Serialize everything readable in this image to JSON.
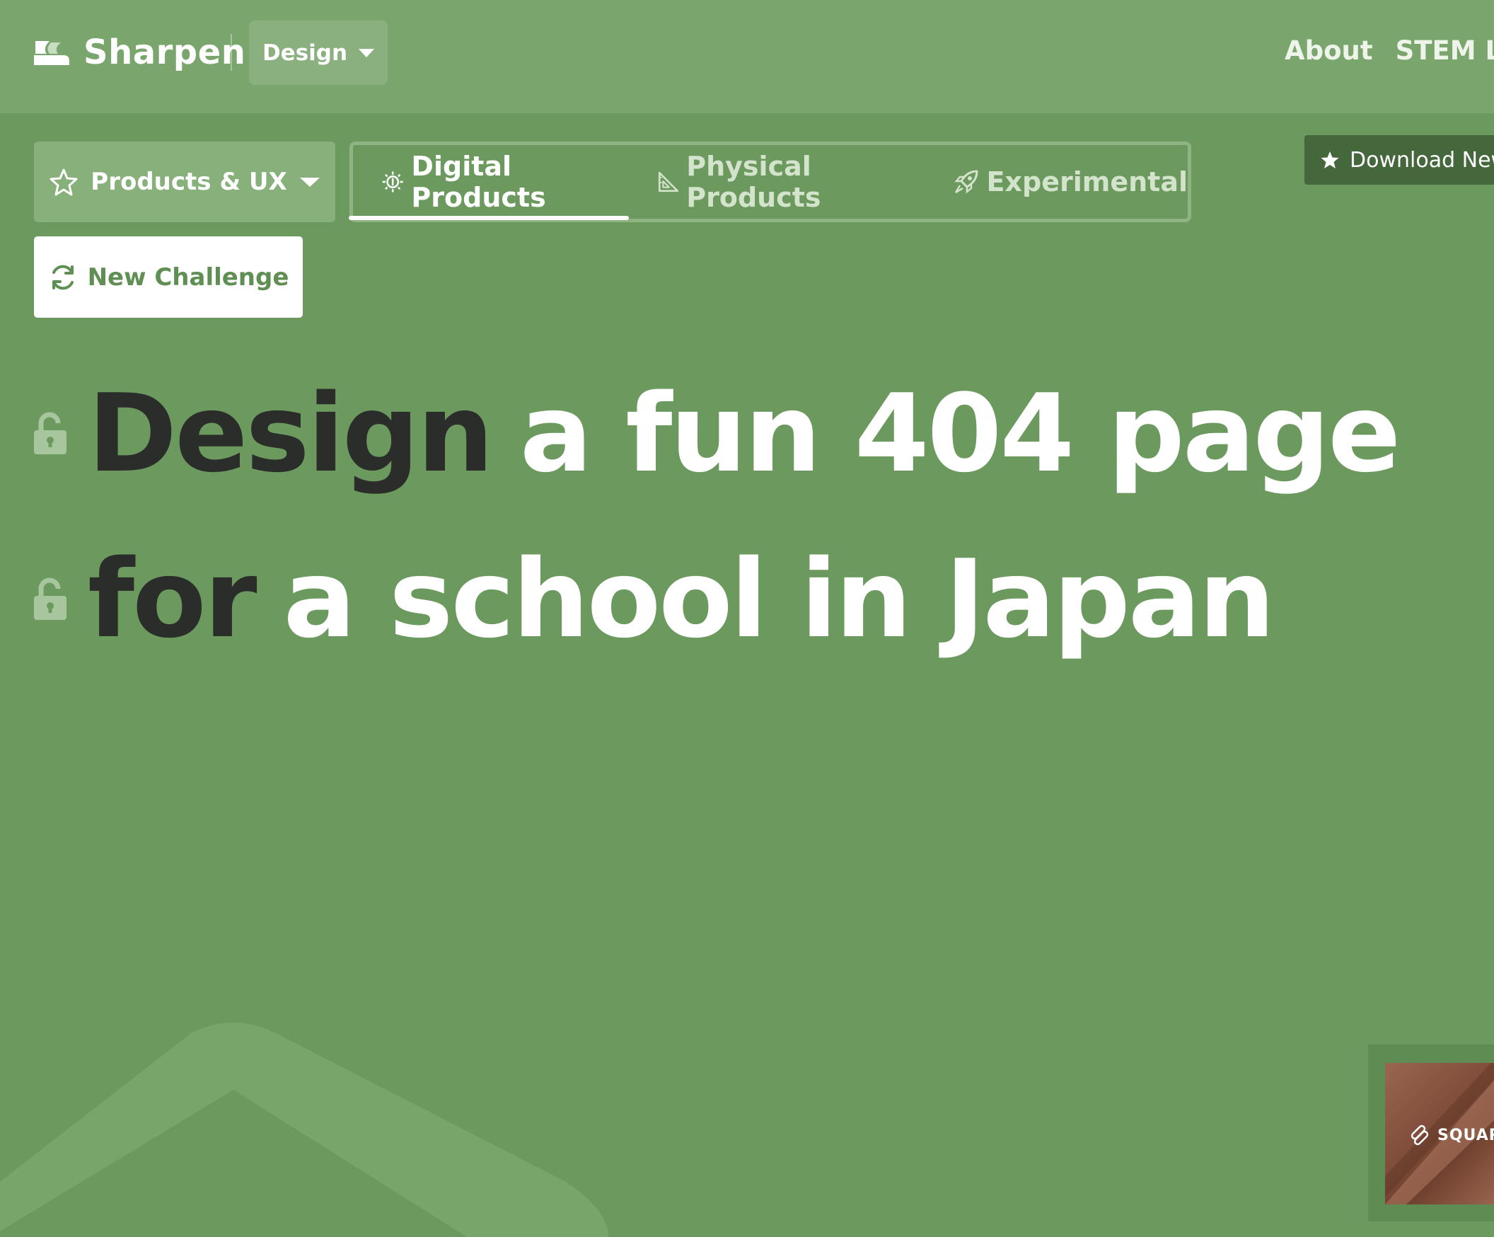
{
  "header": {
    "logo_text": "Sharpen",
    "subject_dropdown_label": "Design",
    "nav_links": [
      "About",
      "STEM Les"
    ]
  },
  "toolbar": {
    "category_label": "Products & UX",
    "tabs": [
      {
        "label": "Digital Products",
        "icon": "cpu-chip-icon",
        "active": true
      },
      {
        "label": "Physical Products",
        "icon": "set-square-icon",
        "active": false
      },
      {
        "label": "Experimental",
        "icon": "rocket-icon",
        "active": false
      }
    ],
    "download_label": "Download New",
    "new_challenge_label": "New Challenge"
  },
  "challenge": {
    "line1": {
      "verb": "Design",
      "rest": "a fun 404 page"
    },
    "line2": {
      "verb": "for",
      "rest": "a school in Japan"
    }
  },
  "ad": {
    "brand": "SQUARE"
  },
  "colors": {
    "background": "#6b995e",
    "header": "#7aa56c",
    "download_button": "#44673c",
    "accent_text": "#5f8f53",
    "verb_text": "#2b2d2b"
  }
}
